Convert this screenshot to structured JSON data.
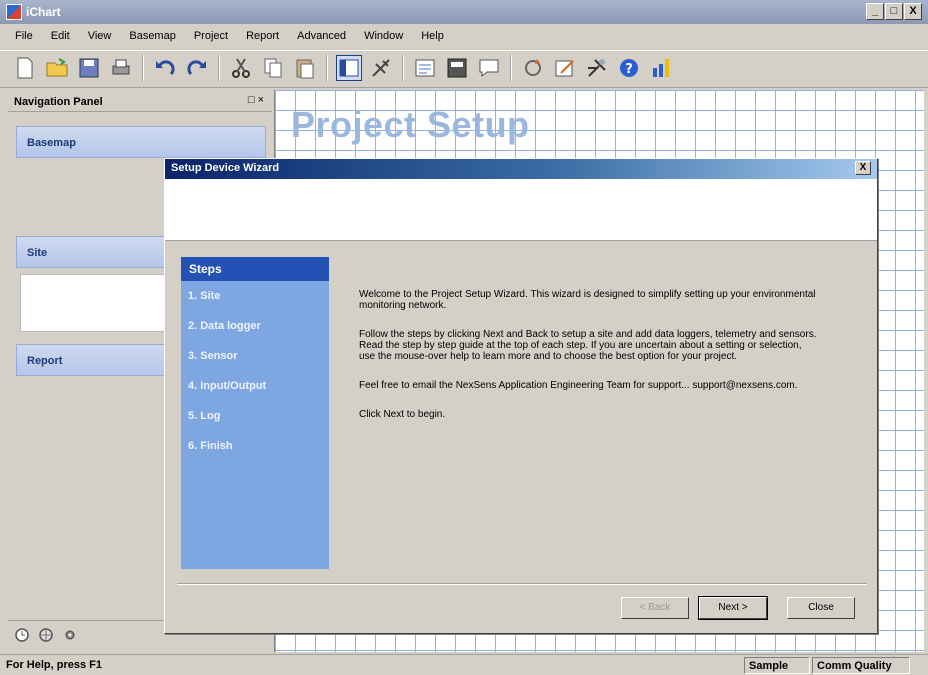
{
  "app": {
    "title": "iChart"
  },
  "window_buttons": [
    "_",
    "□",
    "X"
  ],
  "menu": [
    "File",
    "Edit",
    "View",
    "Basemap",
    "Project",
    "Report",
    "Advanced",
    "Window",
    "Help"
  ],
  "nav_panel": {
    "title": "Navigation Panel",
    "controls": "□ ×",
    "sections": {
      "basemap": "Basemap",
      "site": "Site",
      "report": "Report"
    }
  },
  "workspace": {
    "title": "Project Setup"
  },
  "wizard": {
    "title": "Setup Device Wizard",
    "close": "X",
    "steps_header": "Steps",
    "steps": [
      "1. Site",
      "2. Data logger",
      "3. Sensor",
      "4. Input/Output",
      "5. Log",
      "6. Finish"
    ],
    "paragraphs": [
      "Welcome to the Project Setup Wizard. This wizard is designed to simplify setting up your environmental monitoring network.",
      "Follow the steps by clicking Next and Back to setup a site and add data loggers, telemetry and sensors. Read the step by step guide at the top of each step. If you are uncertain about a setting or selection, use the mouse-over help to learn more and to choose the best option for your project.",
      "Feel free to email the NexSens Application Engineering Team for support... support@nexsens.com.",
      "Click Next to begin."
    ],
    "buttons": {
      "back": "< Back",
      "next": "Next >",
      "close": "Close"
    }
  },
  "status": {
    "help": "For Help, press F1",
    "sample": "Sample",
    "comm_quality": "Comm Quality"
  },
  "colors": {
    "steps_panel": "#7ea6e0",
    "steps_header": "#2452b4",
    "grid": "#8fb2ec",
    "wizard_title": "#0a246a"
  }
}
